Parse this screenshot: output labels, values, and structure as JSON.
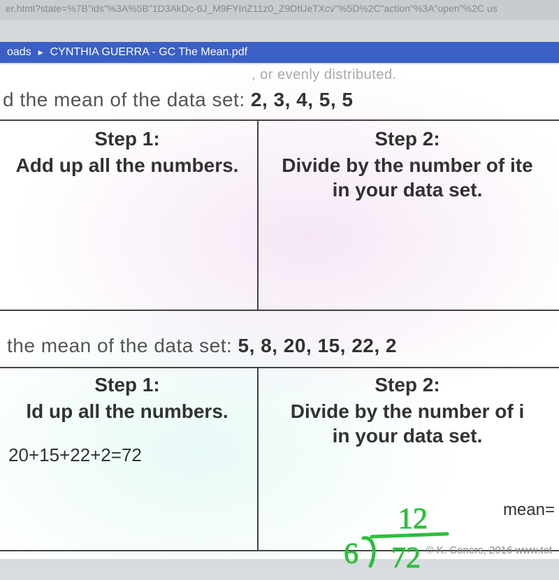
{
  "url_fragment": "er.html?state=%7B\"ids\"%3A%5B\"1D3AkDc-6J_M9FYInZ11z0_Z9DtUeTXcv\"%5D%2C\"action\"%3A\"open\"%2C us",
  "tab": {
    "left_label": "oads",
    "title": "CYNTHIA GUERRA - GC The Mean.pdf"
  },
  "faded_text": ", or evenly distributed.",
  "problem1": {
    "prefix": "d the mean of the data set:  ",
    "dataset": "2, 3, 4, 5, 5",
    "step1_title": "Step 1:",
    "step1_desc": "Add up all the numbers.",
    "step2_title": "Step 2:",
    "step2_desc": "Divide by the number of ite\nin your data set."
  },
  "problem2": {
    "prefix": " the mean of the data set:  ",
    "dataset": "5, 8, 20, 15, 22, 2",
    "step1_title": "Step 1:",
    "step1_desc": "ld up all the numbers.",
    "step2_title": "Step 2:",
    "step2_desc": "Divide by the number of i\nin your data set.",
    "work": "20+15+22+2=72",
    "mean_label": "mean=",
    "hand_divisor": "6",
    "hand_quotient": "12",
    "hand_dividend": "72"
  },
  "footer": "© K. Coners, 2016 www.tot"
}
